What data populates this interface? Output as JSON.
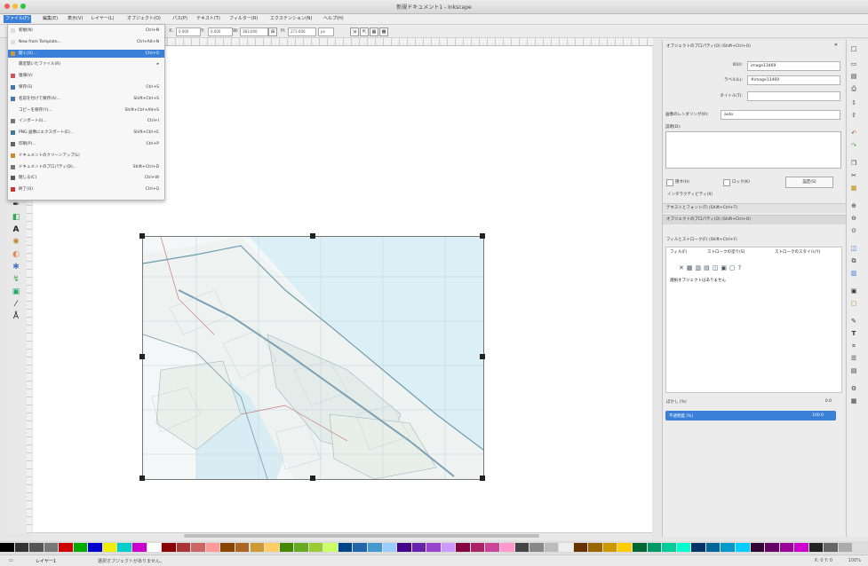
{
  "window": {
    "title": "新規ドキュメント1 - Inkscape"
  },
  "menus": [
    "ファイル(F)",
    "編集(E)",
    "表示(V)",
    "レイヤー(L)",
    "オブジェクト(O)",
    "パス(P)",
    "テキスト(T)",
    "フィルター(R)",
    "エクステンション(N)",
    "ヘルプ(H)"
  ],
  "toolbar": {
    "x_label": "X:",
    "x_value": "0.000",
    "y_label": "Y:",
    "y_value": "0.000",
    "w_label": "W:",
    "w_value": "383.000",
    "h_label": "H:",
    "h_value": "273.000",
    "unit": "px"
  },
  "file_menu": {
    "items": [
      {
        "label": "新規(N)",
        "shortcut": "Ctrl+N",
        "icon": "new-doc-icon"
      },
      {
        "label": "New from Template...",
        "shortcut": "Ctrl+Alt+N",
        "icon": "template-icon"
      },
      {
        "label": "開く(O)...",
        "shortcut": "Ctrl+O",
        "icon": "open-icon",
        "selected": true
      },
      {
        "label": "最近開いたファイル(R)",
        "shortcut": "▸",
        "icon": ""
      },
      {
        "label": "復帰(V)",
        "shortcut": "",
        "icon": "revert-icon"
      },
      {
        "label": "保存(S)",
        "shortcut": "Ctrl+S",
        "icon": "save-icon"
      },
      {
        "label": "名前を付けて保存(A)...",
        "shortcut": "Shift+Ctrl+S",
        "icon": "save-as-icon"
      },
      {
        "label": "コピーを保存(Y)...",
        "shortcut": "Shift+Ctrl+Alt+S",
        "icon": ""
      },
      {
        "label": "インポート(I)...",
        "shortcut": "Ctrl+I",
        "icon": "import-icon"
      },
      {
        "label": "PNG 画像にエクスポート(E)...",
        "shortcut": "Shift+Ctrl+E",
        "icon": "export-icon"
      },
      {
        "label": "印刷(P)...",
        "shortcut": "Ctrl+P",
        "icon": "print-icon"
      },
      {
        "label": "ドキュメントのクリーンアップ(L)",
        "shortcut": "",
        "icon": "cleanup-icon"
      },
      {
        "label": "ドキュメントのプロパティ(D)...",
        "shortcut": "Shift+Ctrl+D",
        "icon": "doc-props-icon"
      },
      {
        "label": "閉じる(C)",
        "shortcut": "Ctrl+W",
        "icon": "close-icon"
      },
      {
        "label": "終了(Q)",
        "shortcut": "Ctrl+Q",
        "icon": "quit-icon"
      }
    ]
  },
  "object_props": {
    "title": "オブジェクトのプロパティ(O) (Shift+Ctrl+O)",
    "id_label": "ID(I):",
    "id_value": "image13469",
    "label_label": "ラベル(L):",
    "label_value": "#image13469",
    "title_label": "タイトル(T):",
    "title_value": "",
    "rendering_label": "画像のレンダリング(R):",
    "rendering_value": "auto",
    "desc_label": "説明(D):",
    "hide_label": "隠す(H)",
    "lock_label": "ロック(K)",
    "set_button": "設定(S)",
    "interactivity": "インタラクティビティ(X)"
  },
  "collapsed_docks": [
    "テキストとフォント(T) (Shift+Ctrl+T)",
    "オブジェクトのプロパティ(O) (Shift+Ctrl+O)"
  ],
  "fill_stroke": {
    "title": "フィルとストローク(F) (Shift+Ctrl+F)",
    "tabs": [
      "フィル(F)",
      "ストロークの塗り(S)",
      "ストロークのスタイル(Y)"
    ],
    "message": "選択オブジェクトはありません",
    "blur_label": "ぼかし (%)",
    "blur_value": "0.0",
    "opacity_label": "不透明度 (%)",
    "opacity_value": "100.0"
  },
  "status": {
    "text": "選択オブジェクトがありません。",
    "layer": "レイヤー1",
    "coords": "X: 0  Y: 0",
    "zoom": "100%"
  },
  "colors": {
    "accent": "#3a7fd8",
    "canvas": "#ffffff",
    "chrome": "#ececec"
  }
}
